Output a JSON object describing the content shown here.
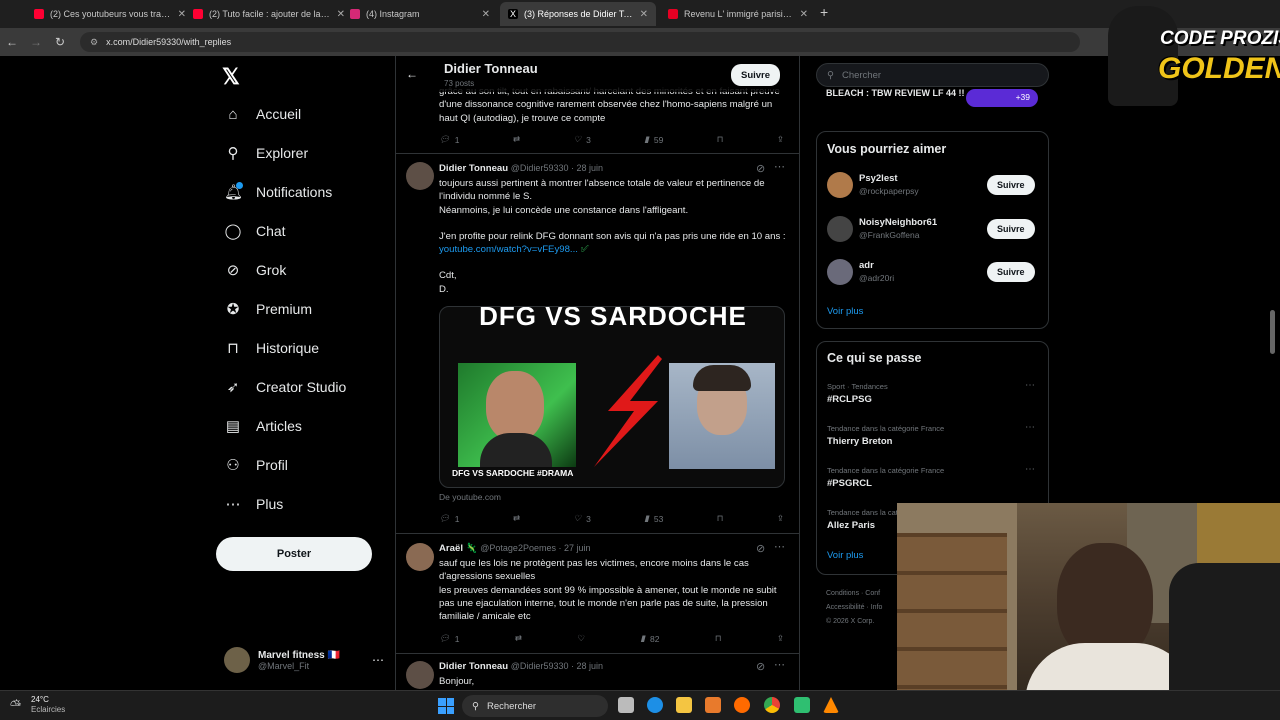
{
  "browser": {
    "tabs": [
      {
        "title": "(2) Ces youtubeurs vous trahiss",
        "color": "#ff0033"
      },
      {
        "title": "(2) Tuto facile : ajouter de la RA",
        "color": "#ff0033"
      },
      {
        "title": "(4) Instagram",
        "color": "#d62976"
      },
      {
        "title": "(3) Réponses de Didier Tonneau",
        "color": "#000000",
        "active": true
      },
      {
        "title": "Revenu L' immigré parisien - co",
        "color": "#e60023"
      }
    ],
    "url": "x.com/Didier59330/with_replies"
  },
  "nav": {
    "items": [
      {
        "label": "Accueil",
        "icon": "home-icon",
        "glyph": "⌂"
      },
      {
        "label": "Explorer",
        "icon": "search-icon",
        "glyph": "⚲"
      },
      {
        "label": "Notifications",
        "icon": "bell-icon",
        "glyph": "🔔︎"
      },
      {
        "label": "Chat",
        "icon": "chat-icon",
        "glyph": "◯"
      },
      {
        "label": "Grok",
        "icon": "grok-icon",
        "glyph": "⊘"
      },
      {
        "label": "Premium",
        "icon": "premium-icon",
        "glyph": "✪"
      },
      {
        "label": "Historique",
        "icon": "bookmark-icon",
        "glyph": "⊓"
      },
      {
        "label": "Creator Studio",
        "icon": "rocket-icon",
        "glyph": "➶"
      },
      {
        "label": "Articles",
        "icon": "article-icon",
        "glyph": "▤"
      },
      {
        "label": "Profil",
        "icon": "profile-icon",
        "glyph": "⚇"
      },
      {
        "label": "Plus",
        "icon": "more-icon",
        "glyph": "⋯"
      }
    ],
    "post_label": "Poster",
    "me": {
      "name": "Marvel fitness 🇫🇷",
      "handle": "@Marvel_Fit"
    }
  },
  "profile_header": {
    "name": "Didier Tonneau",
    "posts": "73 posts",
    "follow": "Suivre"
  },
  "tweets": {
    "first_tail": "grâce au son tilt, tout en rabaissant/ harcelant des minorités et en faisant preuve d'une dissonance cognitive rarement observée chez l'homo-sapiens malgré un haut QI (autodiag), je trouve ce compte",
    "first_stats": {
      "replies": "1",
      "likes": "3",
      "views": "59"
    },
    "second": {
      "name": "Didier Tonneau",
      "handle": "@Didier59330 · 28 juin",
      "p1": "toujours aussi pertinent à montrer l'absence totale de valeur et pertinence de l'individu nommé le S.",
      "p2": "Néanmoins, je lui concède une constance dans l'affligeant.",
      "p3": "J'en profite pour relink DFG donnant son avis qui n'a pas pris une ride en 10 ans :",
      "link": "youtube.com/watch?v=vFEy98...",
      "sign1": "Cdt,",
      "sign2": "D.",
      "card_banner": "DFG VS SARDOCHE",
      "card_caption": "DFG VS SARDOCHE #DRAMA",
      "card_source": "De youtube.com",
      "stats": {
        "replies": "1",
        "likes": "3",
        "views": "53"
      }
    },
    "third": {
      "name": "Araël 🦎",
      "handle": "@Potage2Poemes · 27 juin",
      "text": "sauf que les lois ne protègent pas les victimes, encore moins dans le cas d'agressions sexuelles\nles preuves demandées sont 99 % impossible à amener, tout le monde ne subit pas une ejaculation interne, tout le monde n'en parle pas de suite, la pression familiale / amicale etc",
      "stats": {
        "replies": "1",
        "views": "82"
      }
    },
    "fourth": {
      "name": "Didier Tonneau",
      "handle": "@Didier59330 · 28 juin",
      "text": "Bonjour,"
    }
  },
  "sidebar": {
    "search_placeholder": "Chercher",
    "top_snippet": "BLEACH : TBW REVIEW LF 44 !!",
    "top_count": "+39",
    "suggest_title": "Vous pourriez aimer",
    "suggestions": [
      {
        "name": "Psy2lest",
        "handle": "@rockpaperpsy",
        "btn": "Suivre"
      },
      {
        "name": "NoisyNeighbor61",
        "handle": "@FrankGoffena",
        "btn": "Suivre"
      },
      {
        "name": "adr",
        "handle": "@adr20ri",
        "btn": "Suivre"
      }
    ],
    "see_more": "Voir plus",
    "trends_title": "Ce qui se passe",
    "trends": [
      {
        "meta": "Sport · Tendances",
        "name": "#RCLPSG"
      },
      {
        "meta": "Tendance dans la catégorie France",
        "name": "Thierry Breton"
      },
      {
        "meta": "Tendance dans la catégorie France",
        "name": "#PSGRCL"
      },
      {
        "meta": "Tendance dans la catégorie France",
        "name": "Allez Paris"
      }
    ],
    "trends_more": "Voir plus",
    "footer1": "Conditions  ·  Conf",
    "footer2": "Accessibilité  ·  Info",
    "footer3": "© 2026 X Corp."
  },
  "taskbar": {
    "temp": "24°C",
    "weather": "Eclaircies",
    "search": "Rechercher"
  },
  "overlay": {
    "logo_line1": "CODE PROZIS",
    "logo_line2": "GOLDENG"
  },
  "colors": {
    "accent": "#1d9bf0",
    "bg": "#000000",
    "border": "#2f3336"
  }
}
